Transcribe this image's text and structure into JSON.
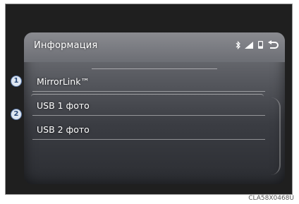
{
  "header": {
    "title": "Информация"
  },
  "status_icons": [
    "bluetooth-icon",
    "signal-icon",
    "phone-icon",
    "back-icon"
  ],
  "items": [
    {
      "label": "MirrorLink™",
      "callout": "1"
    },
    {
      "label": "USB 1 фото",
      "callout": "2"
    },
    {
      "label": "USB 2 фото"
    }
  ],
  "caption": "CLA58X0468U",
  "colors": {
    "text": "#ffffff",
    "callout_fill": "#dfe7f2",
    "callout_border": "#5a78a8"
  }
}
